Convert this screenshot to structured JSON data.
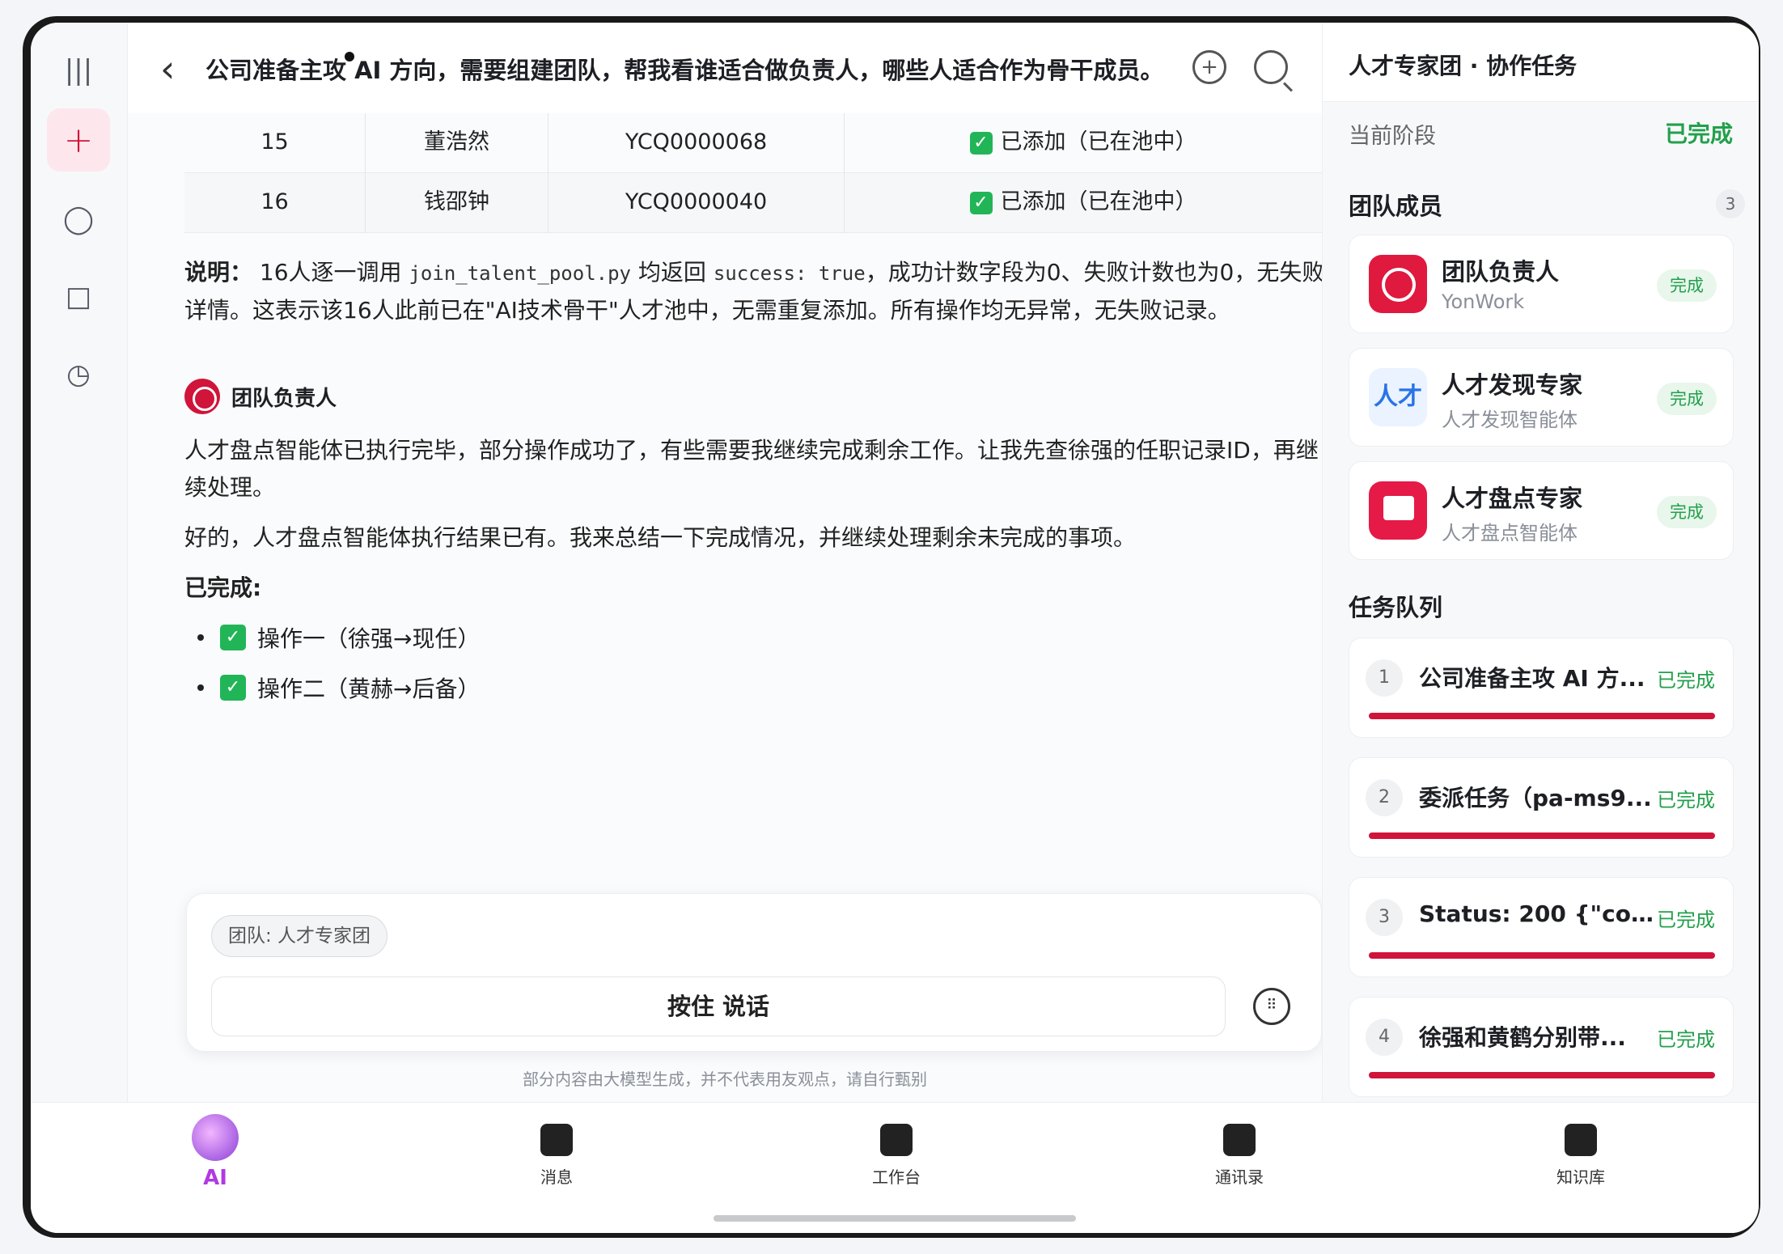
{
  "header": {
    "title": "公司准备主攻 AI 方向，需要组建团队，帮我看谁适合做负责人，哪些人适合作为骨干成员。"
  },
  "table": {
    "rows": [
      {
        "index": "15",
        "name": "董浩然",
        "id": "YCQ0000068",
        "status": "已添加（已在池中）"
      },
      {
        "index": "16",
        "name": "钱邵钟",
        "id": "YCQ0000040",
        "status": "已添加（已在池中）"
      }
    ]
  },
  "note": {
    "label": "说明：",
    "pre": "16人逐一调用",
    "code1": "join_talent_pool.py",
    "mid": "均返回",
    "code2": "success: true",
    "post": "，成功计数字段为0、失败计数也为0，无失败详情。这表示该16人此前已在\"AI技术骨干\"人才池中，无需重复添加。所有操作均无异常，无失败记录。"
  },
  "agent_message": {
    "name": "团队负责人",
    "p1": "人才盘点智能体已执行完毕，部分操作成功了，有些需要我继续完成剩余工作。让我先查徐强的任职记录ID，再继续处理。",
    "p2": "好的，人才盘点智能体执行结果已有。我来总结一下完成情况，并继续处理剩余未完成的事项。",
    "done_label": "已完成:",
    "bullets": [
      "操作一（徐强→现任）",
      "操作二（黄赫→后备）"
    ]
  },
  "composer": {
    "team_chip": "团队: 人才专家团",
    "voice_label": "按住 说话",
    "disclaimer": "部分内容由大模型生成，并不代表用友观点，请自行甄别"
  },
  "panel": {
    "title": "人才专家团 · 协作任务",
    "stage_label": "当前阶段",
    "stage_value": "已完成",
    "members_title": "团队成员",
    "members_count": "3",
    "members": [
      {
        "name": "团队负责人",
        "sub": "YonWork",
        "badge": "完成",
        "icon": "red-logo-icon"
      },
      {
        "name": "人才发现专家",
        "sub": "人才发现智能体",
        "badge": "完成",
        "icon": "人才"
      },
      {
        "name": "人才盘点专家",
        "sub": "人才盘点智能体",
        "badge": "完成",
        "icon": "presentation-icon"
      }
    ],
    "queue_title": "任务队列",
    "tasks": [
      {
        "num": "1",
        "text": "公司准备主攻 AI 方...",
        "status": "已完成",
        "progress": 1.0
      },
      {
        "num": "2",
        "text": "委派任务（pa-ms9...",
        "status": "已完成",
        "progress": 1.0
      },
      {
        "num": "3",
        "text": "Status: 200 {\"code...",
        "status": "已完成",
        "progress": 1.0
      },
      {
        "num": "4",
        "text": "徐强和黄鹤分别带...",
        "status": "已完成",
        "progress": 1.0
      }
    ]
  },
  "nav": {
    "items": [
      {
        "label": "AI"
      },
      {
        "label": "消息"
      },
      {
        "label": "工作台"
      },
      {
        "label": "通讯录"
      },
      {
        "label": "知识库"
      }
    ]
  },
  "colors": {
    "accent": "#d0143a",
    "success": "#22a04b",
    "ai": "#b03ae0"
  }
}
